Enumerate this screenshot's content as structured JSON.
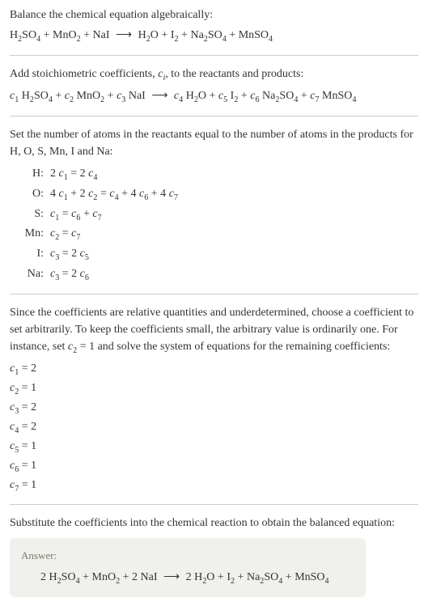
{
  "section1": {
    "line1": "Balance the chemical equation algebraically:",
    "eq_parts": {
      "r1": "H",
      "r1s": "2",
      "r1b": "SO",
      "r1bs": "4",
      "r2": "MnO",
      "r2s": "2",
      "r3": "NaI",
      "p1": "H",
      "p1s": "2",
      "p1b": "O",
      "p2": "I",
      "p2s": "2",
      "p3": "Na",
      "p3s": "2",
      "p3b": "SO",
      "p3bs": "4",
      "p4": "MnSO",
      "p4s": "4"
    }
  },
  "section2": {
    "line1_a": "Add stoichiometric coefficients, ",
    "line1_b": ", to the reactants and products:",
    "ci": "c",
    "ci_sub": "i",
    "c1": "c",
    "c1s": "1",
    "c2": "c",
    "c2s": "2",
    "c3": "c",
    "c3s": "3",
    "c4": "c",
    "c4s": "4",
    "c5": "c",
    "c5s": "5",
    "c6": "c",
    "c6s": "6",
    "c7": "c",
    "c7s": "7"
  },
  "section3": {
    "line1": "Set the number of atoms in the reactants equal to the number of atoms in the products for H, O, S, Mn, I and Na:",
    "atoms": [
      {
        "label": "H:",
        "eq_a": "2 ",
        "eq_b": " = 2 "
      },
      {
        "label": "O:",
        "eq_a": "4 ",
        "eq_b": " + 2 ",
        "eq_c": " = ",
        "eq_d": " + 4 ",
        "eq_e": " + 4 "
      },
      {
        "label": "S:",
        "eq_b": " = ",
        "eq_c": " + "
      },
      {
        "label": "Mn:",
        "eq_b": " = "
      },
      {
        "label": "I:",
        "eq_b": " = 2 "
      },
      {
        "label": "Na:",
        "eq_b": " = 2 "
      }
    ]
  },
  "section4": {
    "line1": "Since the coefficients are relative quantities and underdetermined, choose a coefficient to set arbitrarily. To keep the coefficients small, the arbitrary value is ordinarily one. For instance, set ",
    "line1_b": " = 1 and solve the system of equations for the remaining coefficients:",
    "coeffs": [
      {
        "c": "c",
        "s": "1",
        "v": " = 2"
      },
      {
        "c": "c",
        "s": "2",
        "v": " = 1"
      },
      {
        "c": "c",
        "s": "3",
        "v": " = 2"
      },
      {
        "c": "c",
        "s": "4",
        "v": " = 2"
      },
      {
        "c": "c",
        "s": "5",
        "v": " = 1"
      },
      {
        "c": "c",
        "s": "6",
        "v": " = 1"
      },
      {
        "c": "c",
        "s": "7",
        "v": " = 1"
      }
    ]
  },
  "section5": {
    "line1": "Substitute the coefficients into the chemical reaction to obtain the balanced equation:"
  },
  "answer": {
    "label": "Answer:",
    "two_a": "2 ",
    "two_b": "2 ",
    "two_c": "2 ",
    "plus": " + "
  }
}
